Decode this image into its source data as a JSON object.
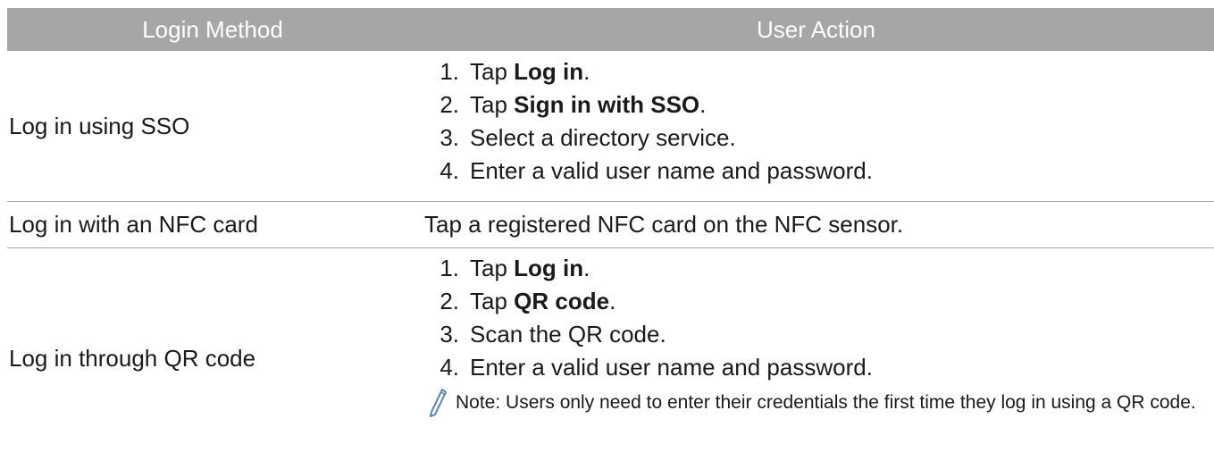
{
  "header": {
    "col1": "Login Method",
    "col2": "User Action"
  },
  "rows": [
    {
      "method": "Log in using SSO",
      "steps": [
        {
          "num": "1.",
          "pre": "Tap ",
          "bold": "Log in",
          "post": "."
        },
        {
          "num": "2.",
          "pre": "Tap ",
          "bold": "Sign in with SSO",
          "post": "."
        },
        {
          "num": "3.",
          "pre": "Select a directory service.",
          "bold": "",
          "post": ""
        },
        {
          "num": "4.",
          "pre": "Enter a valid user name and password.",
          "bold": "",
          "post": ""
        }
      ]
    },
    {
      "method": "Log in with an NFC card",
      "action": "Tap a registered NFC card on the NFC sensor."
    },
    {
      "method": "Log in through QR code",
      "steps": [
        {
          "num": "1.",
          "pre": "Tap ",
          "bold": "Log in",
          "post": "."
        },
        {
          "num": "2.",
          "pre": "Tap ",
          "bold": "QR code",
          "post": "."
        },
        {
          "num": "3.",
          "pre": "Scan the QR code.",
          "bold": "",
          "post": ""
        },
        {
          "num": "4.",
          "pre": "Enter a valid user name and password.",
          "bold": "",
          "post": ""
        }
      ],
      "note": "Note: Users only need to enter their credentials the first time they log in using a QR code."
    }
  ],
  "icons": {
    "note": "pencil-icon"
  },
  "colors": {
    "header_bg": "#a6a6a6",
    "header_text": "#ffffff",
    "rule": "#a6a6a6",
    "note_icon": "#5a7fb8"
  }
}
